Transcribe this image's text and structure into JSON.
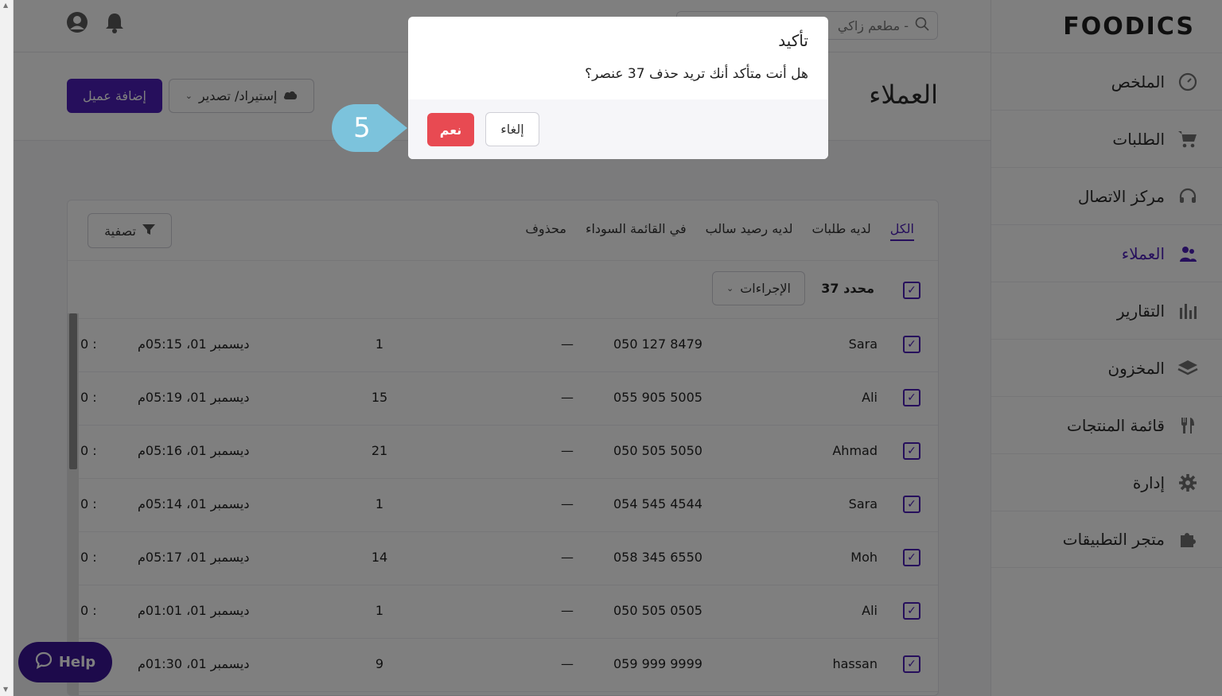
{
  "app": {
    "logo": "FOODICS",
    "search_value": "مطعم زاكي -"
  },
  "sidebar": {
    "items": [
      {
        "label": "الملخص",
        "icon": "dashboard-icon"
      },
      {
        "label": "الطلبات",
        "icon": "cart-icon"
      },
      {
        "label": "مركز الاتصال",
        "icon": "headset-icon"
      },
      {
        "label": "العملاء",
        "icon": "customers-icon"
      },
      {
        "label": "التقارير",
        "icon": "bar-chart-icon"
      },
      {
        "label": "المخزون",
        "icon": "layers-icon"
      },
      {
        "label": "قائمة المنتجات",
        "icon": "utensils-icon"
      },
      {
        "label": "إدارة",
        "icon": "gear-icon"
      },
      {
        "label": "متجر التطبيقات",
        "icon": "puzzle-icon"
      }
    ],
    "active_index": 3
  },
  "header": {
    "title": "العملاء",
    "add_button": "إضافة عميل",
    "import_export": "إستيراد/ تصدير"
  },
  "tabs": [
    "الكل",
    "لديه طلبات",
    "لديه رصيد سالب",
    "في القائمة السوداء",
    "محذوف"
  ],
  "filter_label": "تصفية",
  "selection": {
    "count_label": "37 محدد",
    "actions_label": "الإجراءات"
  },
  "rows": [
    {
      "name": "Sara",
      "phone": "050 127 8479",
      "dash": "—",
      "count": "1",
      "date": "ديسمبر 01، 05:15م",
      "trunc": "0 :"
    },
    {
      "name": "Ali",
      "phone": "055 905 5005",
      "dash": "—",
      "count": "15",
      "date": "ديسمبر 01، 05:19م",
      "trunc": "0 :"
    },
    {
      "name": "Ahmad",
      "phone": "050 505 5050",
      "dash": "—",
      "count": "21",
      "date": "ديسمبر 01، 05:16م",
      "trunc": "0 :"
    },
    {
      "name": "Sara",
      "phone": "054 545 4544",
      "dash": "—",
      "count": "1",
      "date": "ديسمبر 01، 05:14م",
      "trunc": "0 :"
    },
    {
      "name": "Moh",
      "phone": "058 345 6550",
      "dash": "—",
      "count": "14",
      "date": "ديسمبر 01، 05:17م",
      "trunc": "0 :"
    },
    {
      "name": "Ali",
      "phone": "050 505 0505",
      "dash": "—",
      "count": "1",
      "date": "ديسمبر 01، 01:01م",
      "trunc": "0 :"
    },
    {
      "name": "hassan",
      "phone": "059 999 9999",
      "dash": "—",
      "count": "9",
      "date": "ديسمبر 01، 01:30م",
      "trunc": "0 :"
    }
  ],
  "help_label": "Help",
  "modal": {
    "title": "تأكيد",
    "message": "هل أنت متأكد أنك تريد حذف 37 عنصر؟",
    "cancel": "إلغاء",
    "confirm": "نعم"
  },
  "step_badge": "5",
  "colors": {
    "primary": "#4c1fb8",
    "danger": "#e84a52",
    "step": "#7cc3dc"
  }
}
